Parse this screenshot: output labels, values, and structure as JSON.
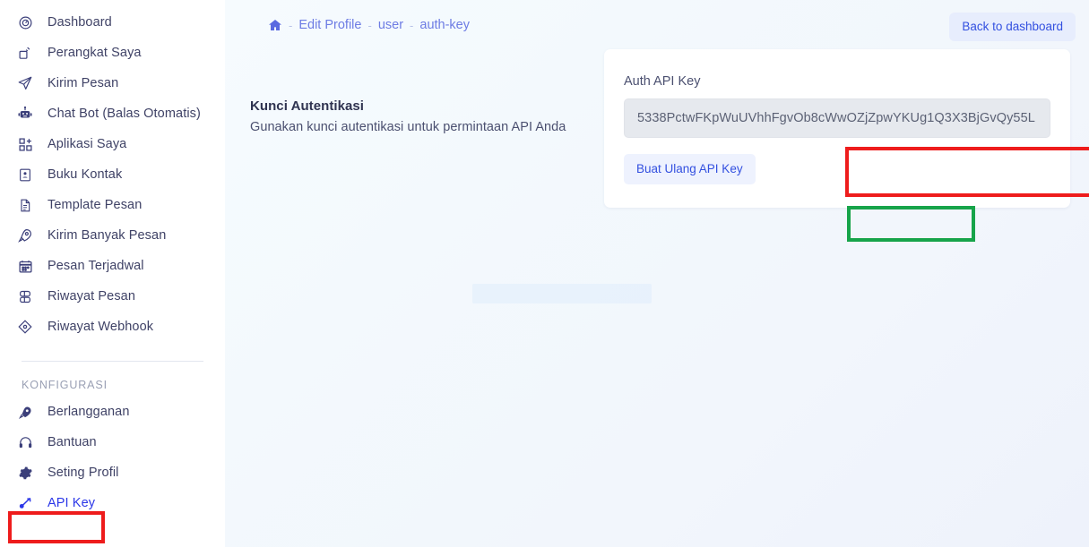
{
  "sidebar": {
    "main_items": [
      {
        "label": "Dashboard",
        "icon": "gauge-icon",
        "active": false
      },
      {
        "label": "Perangkat Saya",
        "icon": "device-broadcast-icon",
        "active": false
      },
      {
        "label": "Kirim Pesan",
        "icon": "paper-plane-icon",
        "active": false
      },
      {
        "label": "Chat Bot (Balas Otomatis)",
        "icon": "robot-icon",
        "active": false
      },
      {
        "label": "Aplikasi Saya",
        "icon": "apps-grid-icon",
        "active": false
      },
      {
        "label": "Buku Kontak",
        "icon": "contact-book-icon",
        "active": false
      },
      {
        "label": "Template Pesan",
        "icon": "document-icon",
        "active": false
      },
      {
        "label": "Kirim Banyak Pesan",
        "icon": "rocket-icon",
        "active": false
      },
      {
        "label": "Pesan Terjadwal",
        "icon": "calendar-icon",
        "active": false
      },
      {
        "label": "Riwayat Pesan",
        "icon": "history-list-icon",
        "active": false
      },
      {
        "label": "Riwayat Webhook",
        "icon": "webhook-node-icon",
        "active": false
      }
    ],
    "section_title": "KONFIGURASI",
    "config_items": [
      {
        "label": "Berlangganan",
        "icon": "rocket-icon",
        "active": false
      },
      {
        "label": "Bantuan",
        "icon": "headset-support-icon",
        "active": false
      },
      {
        "label": "Seting Profil",
        "icon": "gear-icon",
        "active": false
      },
      {
        "label": "API Key",
        "icon": "key-icon",
        "active": true
      }
    ]
  },
  "topbar": {
    "breadcrumb": {
      "home_icon": "home-icon",
      "separator": "-",
      "items": [
        {
          "label": "Edit Profile"
        },
        {
          "label": "user"
        },
        {
          "label": "auth-key"
        }
      ]
    },
    "back_button_label": "Back to dashboard"
  },
  "content": {
    "section_title": "Kunci Autentikasi",
    "section_subtitle": "Gunakan kunci autentikasi untuk permintaan API Anda",
    "card": {
      "field_label": "Auth API Key",
      "api_key_value": "5338PctwFKpWuUVhhFgvOb8cWwOZjZpwYKUg1Q3X3BjGvQy55L",
      "api_key_placeholder": "Auth API Key",
      "regenerate_button_label": "Buat Ulang API Key"
    }
  },
  "annotations": [
    {
      "name": "api-key-field-highlight",
      "color": "#ee1c1c"
    },
    {
      "name": "regenerate-button-highlight",
      "color": "#17a44a"
    },
    {
      "name": "sidebar-api-key-highlight",
      "color": "#ee1c1c"
    }
  ],
  "colors": {
    "accent_blue": "#2b37e8",
    "link_blue": "#6d7ce4",
    "button_blue": "#3350e0",
    "annotation_red": "#ee1c1c",
    "annotation_green": "#17a44a",
    "sidebar_text": "#3f4266"
  }
}
